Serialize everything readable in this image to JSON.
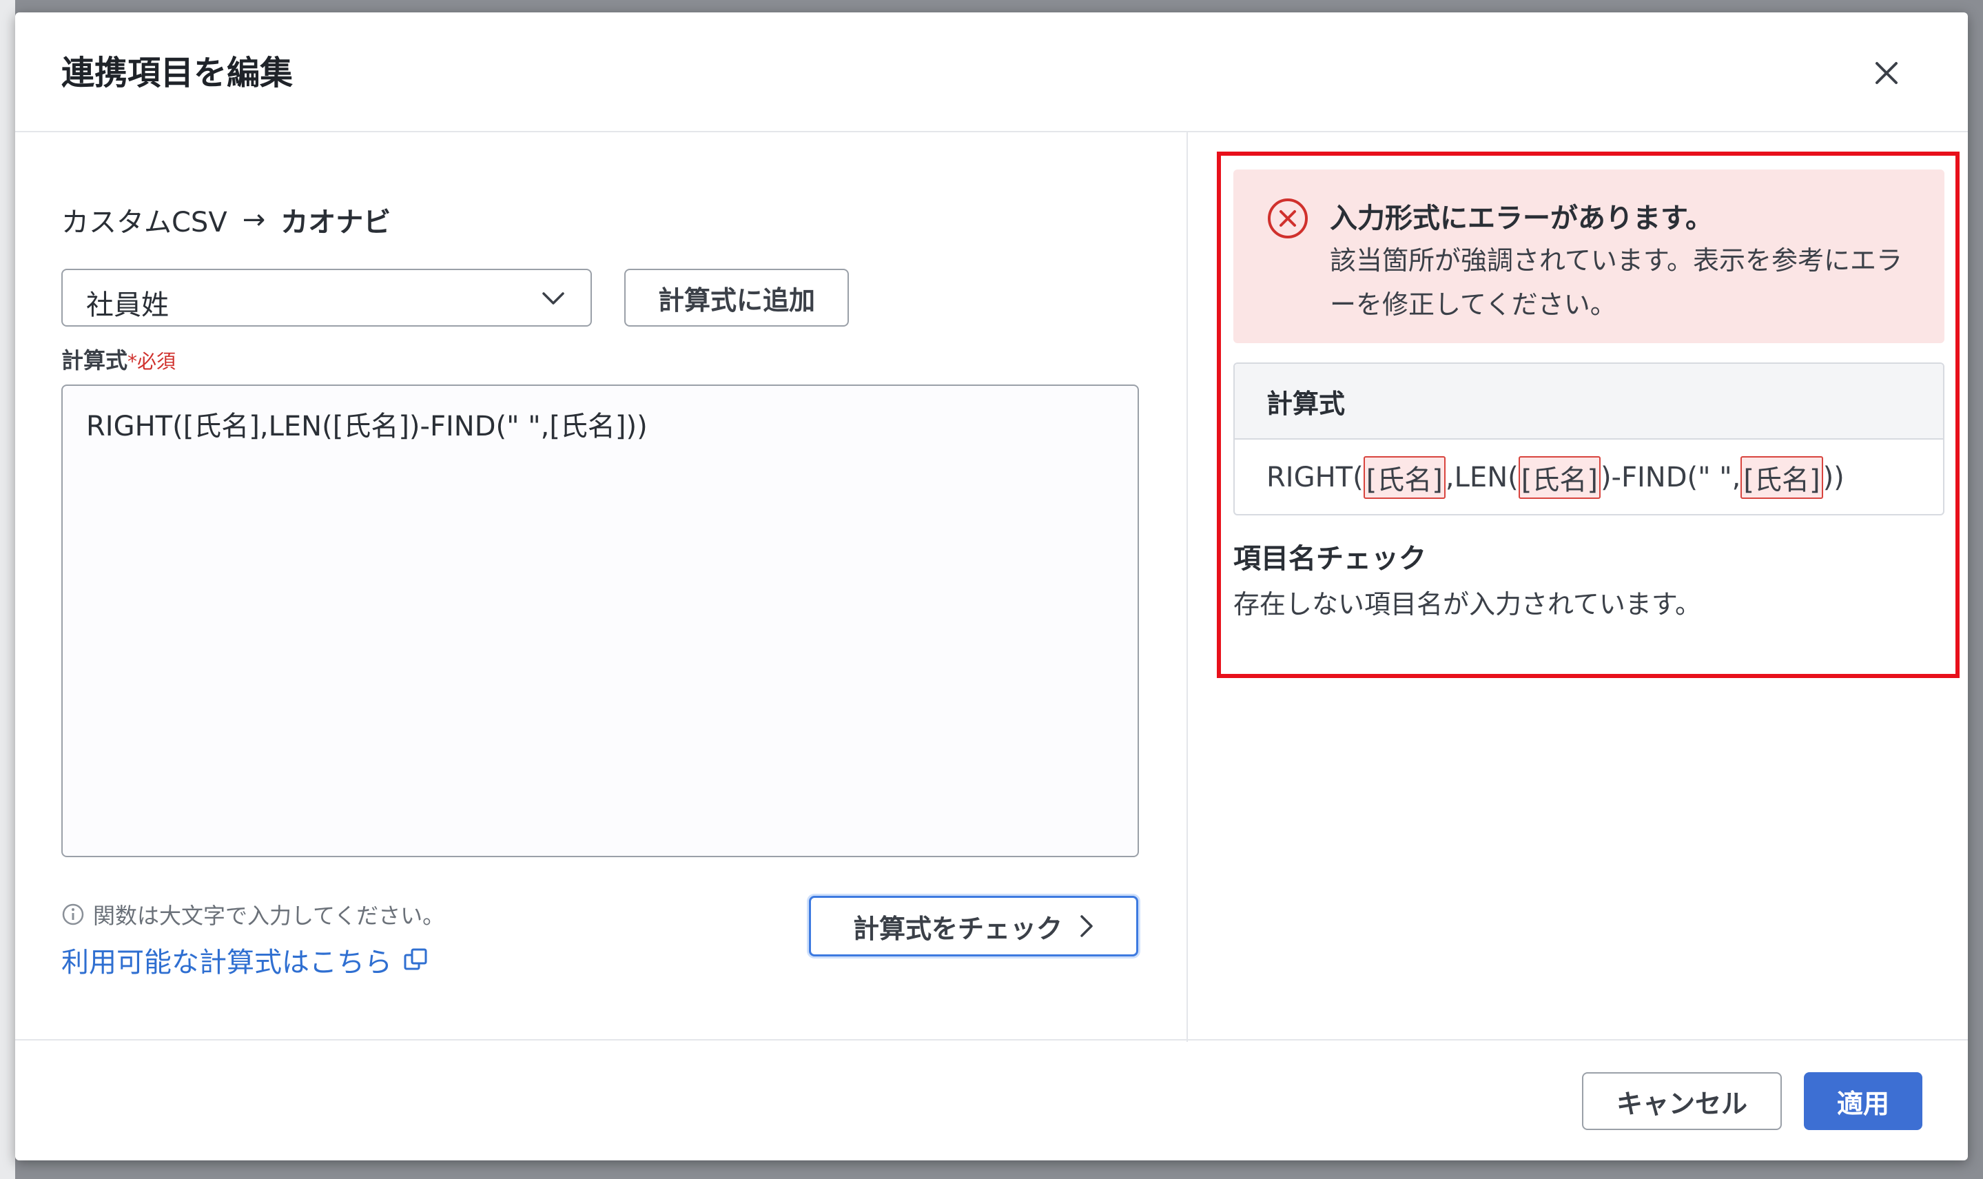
{
  "dialog": {
    "title": "連携項目を編集"
  },
  "mapping": {
    "source": "カスタムCSV",
    "arrow": "→",
    "target": "カオナビ"
  },
  "field_select": {
    "selected": "社員姓"
  },
  "buttons": {
    "add_to_formula": "計算式に追加",
    "check_formula": "計算式をチェック",
    "cancel": "キャンセル",
    "apply": "適用"
  },
  "formula": {
    "label": "計算式",
    "required_mark": "*",
    "required_text": "必須",
    "value": "RIGHT([氏名],LEN([氏名])-FIND(\" \",[氏名]))"
  },
  "hint": {
    "text": "関数は大文字で入力してください。",
    "link": "利用可能な計算式はこちら"
  },
  "error_panel": {
    "title": "入力形式にエラーがあります。",
    "body": "該当箇所が強調されています。表示を参考にエラーを修正してください。",
    "formula_header": "計算式",
    "formula_parts": {
      "p1": "RIGHT(",
      "m1": "[氏名]",
      "p2": ",LEN(",
      "m2": "[氏名]",
      "p3": ")-FIND(\" \",",
      "m3": "[氏名]",
      "p4": "))"
    },
    "check_title": "項目名チェック",
    "check_message": "存在しない項目名が入力されています。"
  },
  "colors": {
    "accent": "#3d6fd3",
    "error_border": "#e8101b",
    "error_bg": "#fbe5e5",
    "link": "#2f6fd1"
  }
}
